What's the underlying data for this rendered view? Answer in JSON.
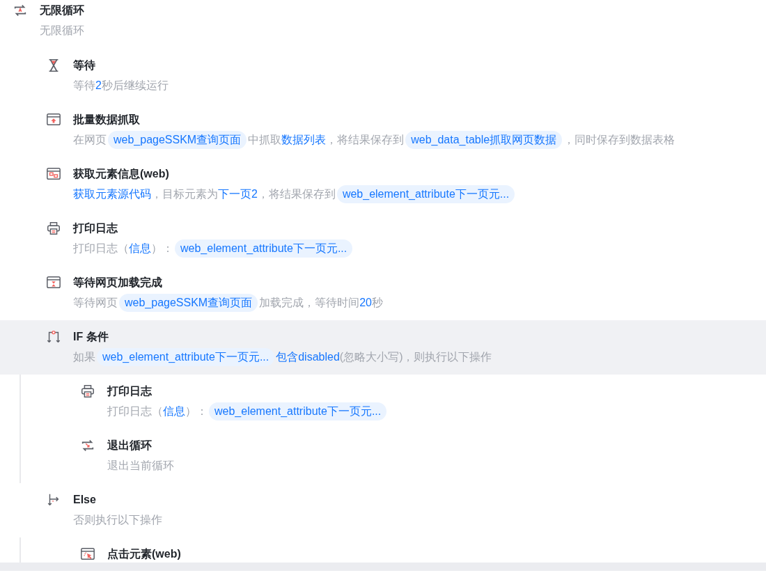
{
  "steps": [
    {
      "kind": "loop",
      "title": "无限循环",
      "selected": false,
      "description": [
        {
          "kind": "text",
          "text": "无限循环"
        }
      ],
      "children": [
        {
          "kind": "wait",
          "title": "等待",
          "selected": false,
          "description": [
            {
              "kind": "text",
              "text": "等待"
            },
            {
              "kind": "link",
              "text": "2"
            },
            {
              "kind": "text",
              "text": "秒后继续运行"
            }
          ]
        },
        {
          "kind": "scrape",
          "title": "批量数据抓取",
          "selected": false,
          "description": [
            {
              "kind": "text",
              "text": "在网页"
            },
            {
              "kind": "chip",
              "text": "web_pageSSKM查询页面"
            },
            {
              "kind": "text",
              "text": "中抓取"
            },
            {
              "kind": "link",
              "text": "数据列表"
            },
            {
              "kind": "text",
              "text": "，将结果保存到"
            },
            {
              "kind": "chip",
              "text": "web_data_table抓取网页数据"
            },
            {
              "kind": "text",
              "text": "，同时保存到数据表格"
            }
          ]
        },
        {
          "kind": "element",
          "title": "获取元素信息(web)",
          "selected": false,
          "description": [
            {
              "kind": "link",
              "text": "获取元素源代码"
            },
            {
              "kind": "text",
              "text": "，目标元素为"
            },
            {
              "kind": "link",
              "text": "下一页2"
            },
            {
              "kind": "text",
              "text": "，将结果保存到"
            },
            {
              "kind": "chip",
              "text": "web_element_attribute下一页元..."
            }
          ]
        },
        {
          "kind": "print",
          "title": "打印日志",
          "selected": false,
          "description": [
            {
              "kind": "text",
              "text": "打印日志（"
            },
            {
              "kind": "link",
              "text": "信息"
            },
            {
              "kind": "text",
              "text": "）："
            },
            {
              "kind": "chip",
              "text": "web_element_attribute下一页元..."
            }
          ]
        },
        {
          "kind": "pageload",
          "title": "等待网页加载完成",
          "selected": false,
          "description": [
            {
              "kind": "text",
              "text": "等待网页"
            },
            {
              "kind": "chip",
              "text": "web_pageSSKM查询页面"
            },
            {
              "kind": "text",
              "text": "加载完成，等待时间"
            },
            {
              "kind": "link",
              "text": "20"
            },
            {
              "kind": "text",
              "text": "秒"
            }
          ]
        },
        {
          "kind": "if",
          "title": "IF 条件",
          "selected": true,
          "description": [
            {
              "kind": "text",
              "text": "如果"
            },
            {
              "kind": "chip",
              "text": "web_element_attribute下一页元..."
            },
            {
              "kind": "link",
              "text": "包含disabled"
            },
            {
              "kind": "text",
              "text": "(忽略大小写)，则执行以下操作"
            }
          ],
          "children": [
            {
              "kind": "print",
              "title": "打印日志",
              "selected": false,
              "description": [
                {
                  "kind": "text",
                  "text": "打印日志（"
                },
                {
                  "kind": "link",
                  "text": "信息"
                },
                {
                  "kind": "text",
                  "text": "）："
                },
                {
                  "kind": "chip",
                  "text": "web_element_attribute下一页元..."
                }
              ]
            },
            {
              "kind": "exit",
              "title": "退出循环",
              "selected": false,
              "description": [
                {
                  "kind": "text",
                  "text": "退出当前循环"
                }
              ]
            }
          ]
        },
        {
          "kind": "else",
          "title": "Else",
          "selected": false,
          "description": [
            {
              "kind": "text",
              "text": "否则执行以下操作"
            }
          ],
          "children": [
            {
              "kind": "click",
              "title": "点击元素(web)",
              "selected": false
            }
          ]
        }
      ]
    }
  ]
}
